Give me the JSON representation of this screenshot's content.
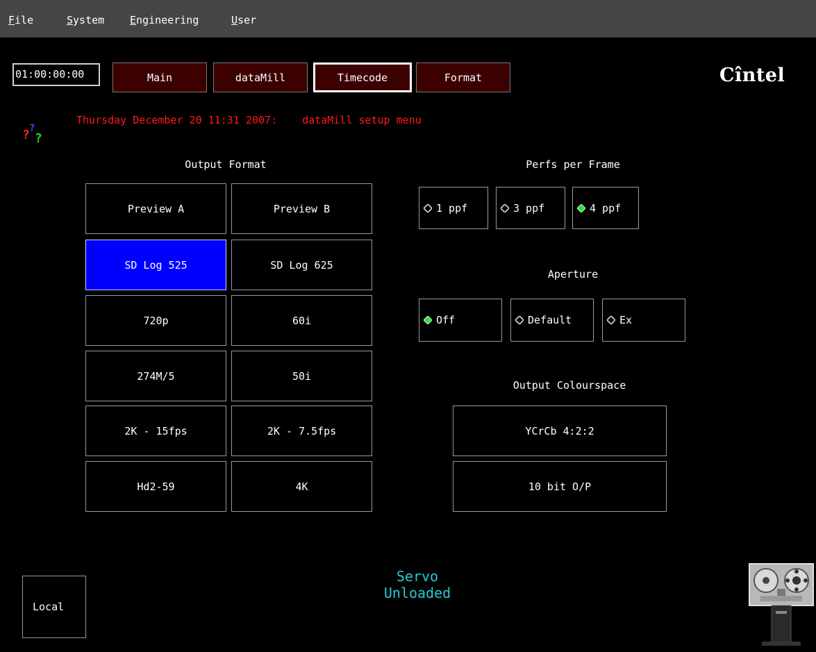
{
  "menu": {
    "file": {
      "mnemonic": "F",
      "rest": "ile"
    },
    "system": {
      "mnemonic": "S",
      "rest": "ystem"
    },
    "engineering": {
      "mnemonic": "E",
      "rest": "ngineering"
    },
    "user": {
      "mnemonic": "U",
      "rest": "ser"
    }
  },
  "timecode_value": "01:00:00:00",
  "tabs": [
    "Main",
    "dataMill",
    "Timecode",
    "Format"
  ],
  "active_tab": "Timecode",
  "logo_text": "Cîntel",
  "status_line": "Thursday December 20 11:31 2007:    dataMill setup menu",
  "output_format": {
    "heading": "Output Format",
    "buttons": [
      "Preview A",
      "Preview B",
      "SD Log 525",
      "SD Log 625",
      "720p",
      "60i",
      "274M/5",
      "50i",
      "2K - 15fps",
      "2K - 7.5fps",
      "Hd2-59",
      "4K"
    ],
    "selected": "SD Log 525"
  },
  "perfs_per_frame": {
    "heading": "Perfs per Frame",
    "options": [
      "1 ppf",
      "3 ppf",
      "4 ppf"
    ],
    "selected": "4 ppf"
  },
  "aperture": {
    "heading": "Aperture",
    "options": [
      "Off",
      "Default",
      "Ex"
    ],
    "selected": "Off"
  },
  "output_colourspace": {
    "heading": "Output Colourspace",
    "buttons": [
      "YCrCb 4:2:2",
      "10 bit O/P"
    ]
  },
  "servo_status": {
    "line1": "Servo",
    "line2": "Unloaded"
  },
  "local_label": "Local",
  "colors": {
    "menubar": "#454545",
    "tab_bg": "#3c0000",
    "selected_bg": "#0000ff",
    "status_text": "#ff1a1a",
    "servo_text": "#27c8d6",
    "radio_active": "#22ee22"
  },
  "icons": {
    "help": "help-question-marks-icon",
    "machine": "telecine-machine-icon",
    "radio_on": "radio-diamond-selected-icon",
    "radio_off": "radio-diamond-unselected-icon"
  }
}
